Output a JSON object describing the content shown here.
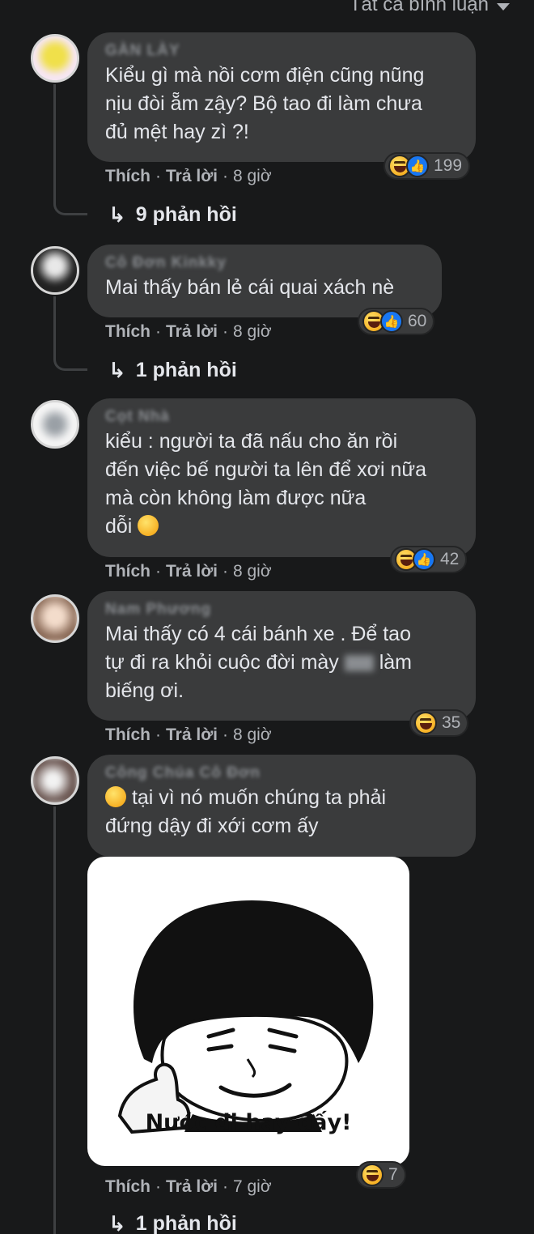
{
  "header": {
    "filter_label": "Tất cả bình luận"
  },
  "colors": {
    "background": "#18191a",
    "bubble": "#3a3b3c",
    "meta_text": "#b0b3b8",
    "like_blue": "#1877f2",
    "haha_yellow": "#f7b125"
  },
  "comments": [
    {
      "name": "GÀN LÀY",
      "text": "Kiểu gì mà nồi cơm điện cũng nũng\nnịu đòi ẵm zậy? Bộ tao đi làm chưa\nđủ mệt hay zì ?!",
      "like_label": "Thích",
      "reply_label": "Trả lời",
      "time": "8 giờ",
      "reactions": {
        "icons": [
          "haha-icon",
          "like-icon"
        ],
        "count": "199"
      },
      "replies_label": "9 phản hồi"
    },
    {
      "name": "Cô Đơn Kinkky",
      "text": "Mai thấy bán lẻ cái quai xách nè",
      "like_label": "Thích",
      "reply_label": "Trả lời",
      "time": "8 giờ",
      "reactions": {
        "icons": [
          "haha-icon",
          "like-icon"
        ],
        "count": "60"
      },
      "replies_label": "1 phản hồi"
    },
    {
      "name": "Cọt Nhà",
      "text": "kiểu : người ta đã nấu cho ăn rồi\nđến việc bế người ta lên để xơi nữa\nmà còn không làm được nữa\ndỗi",
      "like_label": "Thích",
      "reply_label": "Trả lời",
      "time": "8 giờ",
      "reactions": {
        "icons": [
          "haha-icon",
          "like-icon"
        ],
        "count": "42"
      }
    },
    {
      "name": "Nam Phương",
      "text_line1": "Mai thấy có 4 cái bánh xe . Để tao",
      "text_line2a": "tự đi ra khỏi cuộc đời mày ",
      "text_line2b": " làm",
      "text_line3": "biếng ơi.",
      "like_label": "Thích",
      "reply_label": "Trả lời",
      "time": "8 giờ",
      "reactions": {
        "icons": [
          "haha-icon"
        ],
        "count": "35"
      }
    },
    {
      "name": "Công Chúa Cô Đơn",
      "text_line1": " tại vì nó muốn chúng ta phải",
      "text_line2": "đứng dậy đi xới cơm ấy",
      "sticker_caption": "Nước đi hay đấy!",
      "like_label": "Thích",
      "reply_label": "Trả lời",
      "time": "7 giờ",
      "reactions": {
        "icons": [
          "haha-icon"
        ],
        "count": "7"
      },
      "replies_label": "1 phản hồi"
    }
  ]
}
